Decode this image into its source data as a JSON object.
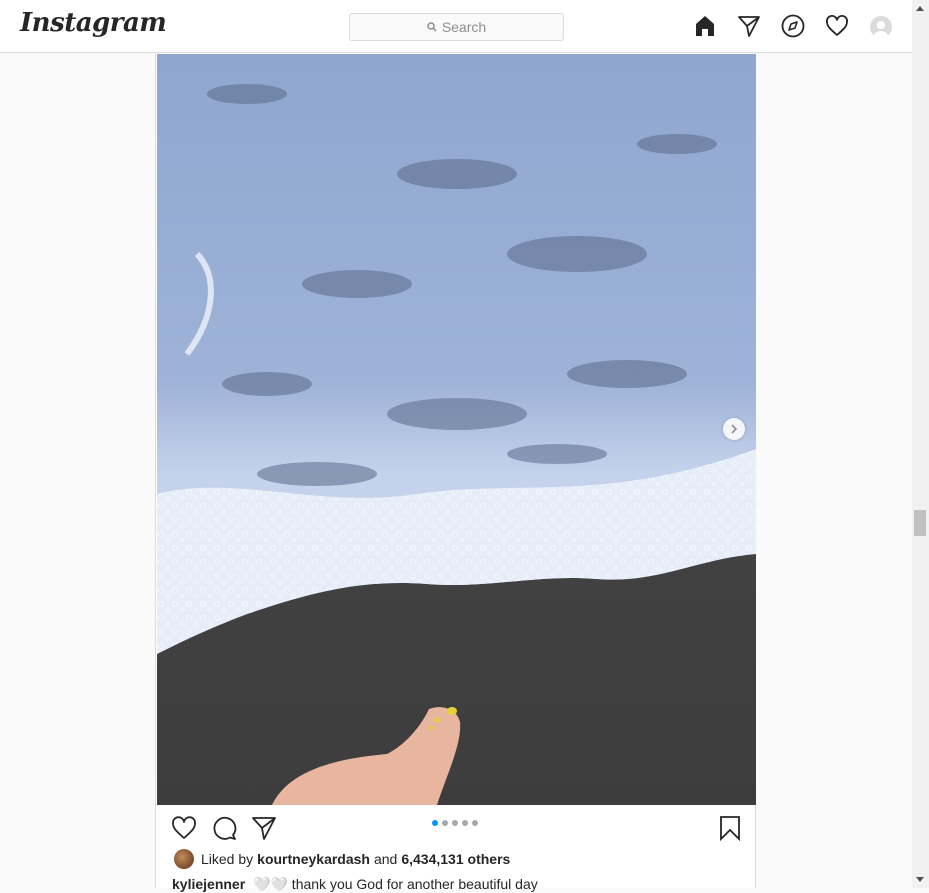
{
  "nav": {
    "logo": "Instagram",
    "search_placeholder": "Search",
    "icons": [
      "home-icon",
      "direct-icon",
      "explore-icon",
      "activity-icon",
      "profile-icon"
    ]
  },
  "post": {
    "photo_description_alt": "",
    "carousel": {
      "total": 5,
      "current": 1
    },
    "likes": {
      "prefix": "Liked by",
      "user": "kourtneykardash",
      "conjunction": "and",
      "others": "6,434,131 others"
    },
    "caption": {
      "author": "kyliejenner",
      "text": "🤍🤍 thank you God for another beautiful day"
    }
  },
  "colors": {
    "accent": "#0095f6",
    "border": "#dbdbdb",
    "text": "#262626"
  }
}
